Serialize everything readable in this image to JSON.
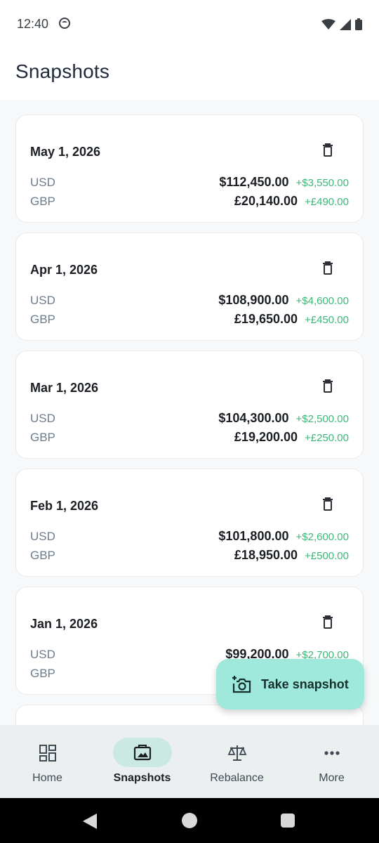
{
  "status_bar": {
    "time": "12:40"
  },
  "header": {
    "title": "Snapshots"
  },
  "snapshots": [
    {
      "date": "May 1, 2026",
      "rows": [
        {
          "currency": "USD",
          "amount": "$112,450.00",
          "delta": "+$3,550.00"
        },
        {
          "currency": "GBP",
          "amount": "£20,140.00",
          "delta": "+£490.00"
        }
      ]
    },
    {
      "date": "Apr 1, 2026",
      "rows": [
        {
          "currency": "USD",
          "amount": "$108,900.00",
          "delta": "+$4,600.00"
        },
        {
          "currency": "GBP",
          "amount": "£19,650.00",
          "delta": "+£450.00"
        }
      ]
    },
    {
      "date": "Mar 1, 2026",
      "rows": [
        {
          "currency": "USD",
          "amount": "$104,300.00",
          "delta": "+$2,500.00"
        },
        {
          "currency": "GBP",
          "amount": "£19,200.00",
          "delta": "+£250.00"
        }
      ]
    },
    {
      "date": "Feb 1, 2026",
      "rows": [
        {
          "currency": "USD",
          "amount": "$101,800.00",
          "delta": "+$2,600.00"
        },
        {
          "currency": "GBP",
          "amount": "£18,950.00",
          "delta": "+£500.00"
        }
      ]
    },
    {
      "date": "Jan 1, 2026",
      "rows": [
        {
          "currency": "USD",
          "amount": "$99,200.00",
          "delta": "+$2,700.00"
        },
        {
          "currency": "GBP",
          "amount": "",
          "delta": ""
        }
      ]
    }
  ],
  "fab": {
    "label": "Take snapshot"
  },
  "bottom_nav": [
    {
      "label": "Home",
      "icon": "dashboard-icon"
    },
    {
      "label": "Snapshots",
      "icon": "photo-album-icon",
      "active": true
    },
    {
      "label": "Rebalance",
      "icon": "scale-icon"
    },
    {
      "label": "More",
      "icon": "more-horiz-icon"
    }
  ],
  "colors": {
    "accent": "#9ee8dc",
    "delta_positive": "#3cb878",
    "nav_active_pill": "#cbe9e3"
  }
}
